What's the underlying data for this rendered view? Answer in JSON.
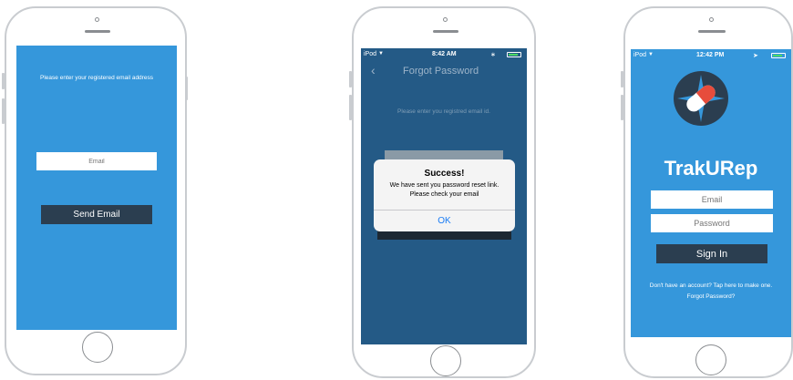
{
  "screen1": {
    "instruction": "Please enter your registered email address",
    "email_placeholder": "Email",
    "send_button": "Send Email"
  },
  "screen2": {
    "status": {
      "carrier": "iPod",
      "time": "8:42 AM"
    },
    "nav_title": "Forgot Password",
    "instruction": "Please enter you registred email id.",
    "alert": {
      "title": "Success!",
      "message_line1": "We have sent you password reset link.",
      "message_line2": "Please check your email",
      "ok": "OK"
    }
  },
  "screen3": {
    "status": {
      "carrier": "iPod",
      "time": "12:42 PM"
    },
    "app_name": "TrakURep",
    "email_placeholder": "Email",
    "password_placeholder": "Password",
    "signin_button": "Sign In",
    "signup_link": "Don't have an account? Tap here to make one.",
    "forgot_link": "Forgot Password?"
  },
  "colors": {
    "app_blue": "#3597db",
    "dimmed_blue": "#245a86",
    "dark_button": "#2b3e50",
    "alert_blue": "#1a7cf4",
    "logo_red": "#e74c3c"
  }
}
